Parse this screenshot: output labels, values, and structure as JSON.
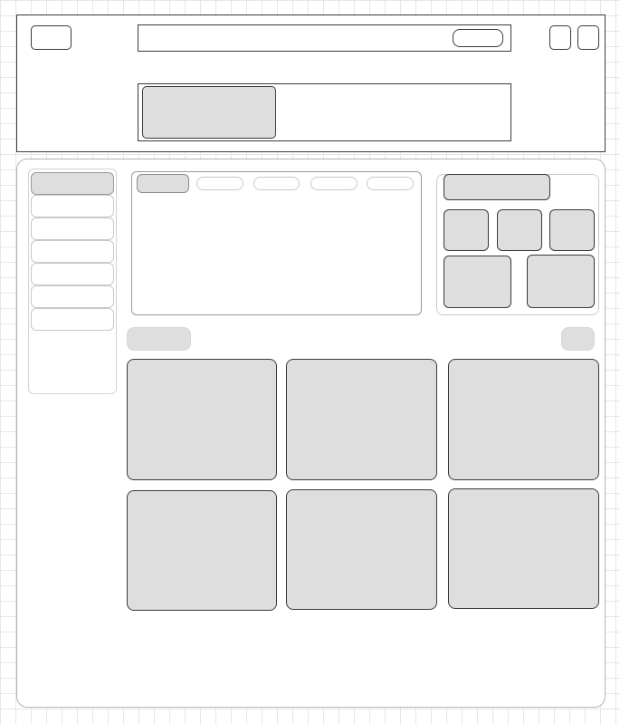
{
  "header": {
    "logo_label": "",
    "search_placeholder": "",
    "search_button_label": "",
    "action_a_label": "",
    "action_b_label": "",
    "banner_thumb_label": "",
    "banner_text": ""
  },
  "sidebar": {
    "items": [
      {
        "label": ""
      },
      {
        "label": ""
      },
      {
        "label": ""
      },
      {
        "label": ""
      },
      {
        "label": ""
      },
      {
        "label": ""
      },
      {
        "label": ""
      }
    ]
  },
  "tabs": {
    "items": [
      {
        "label": ""
      },
      {
        "label": ""
      },
      {
        "label": ""
      },
      {
        "label": ""
      },
      {
        "label": ""
      }
    ]
  },
  "widget": {
    "title": "",
    "tiles": [
      {
        "label": ""
      },
      {
        "label": ""
      },
      {
        "label": ""
      },
      {
        "label": ""
      },
      {
        "label": ""
      }
    ]
  },
  "section": {
    "heading": "",
    "action_label": ""
  },
  "cards": [
    {
      "title": ""
    },
    {
      "title": ""
    },
    {
      "title": ""
    },
    {
      "title": ""
    },
    {
      "title": ""
    },
    {
      "title": ""
    }
  ],
  "colors": {
    "border": "#3a3a3a",
    "fill": "#dedede",
    "light_border": "#c8c8c8"
  }
}
